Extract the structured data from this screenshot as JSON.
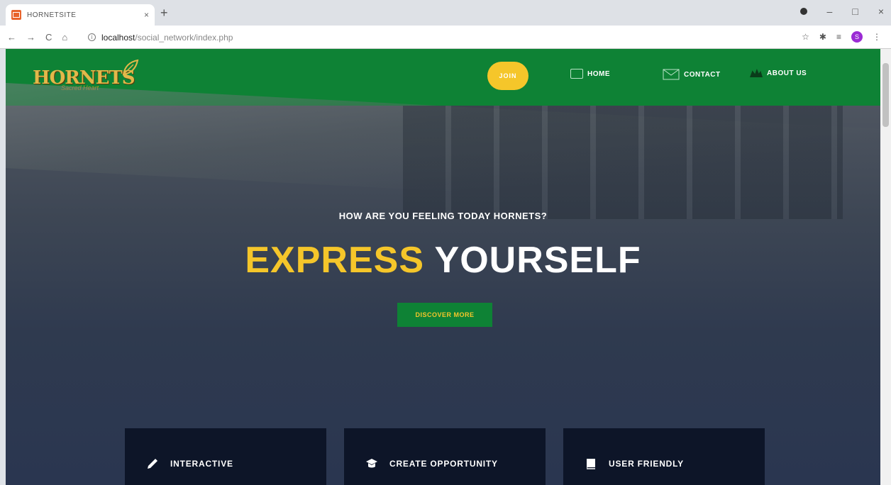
{
  "browser": {
    "tab_title": "HORNETSITE",
    "tab_close": "×",
    "new_tab": "+",
    "url_host": "localhost",
    "url_path": "/social_network/index.php",
    "nav_back": "←",
    "nav_forward": "→",
    "nav_reload": "C",
    "nav_home": "⌂",
    "win_minimize": "–",
    "win_maximize": "□",
    "win_close": "×",
    "avatar_letter": "S"
  },
  "site_nav": {
    "logo_text": "HORNETS",
    "logo_sub": "Sacred Heart",
    "join_label": "JOIN",
    "links": [
      {
        "label": "HOME",
        "icon": "home-icon"
      },
      {
        "label": "CONTACT",
        "icon": "envelope-icon"
      },
      {
        "label": "ABOUT US",
        "icon": "crown-icon"
      }
    ]
  },
  "hero": {
    "subtitle": "HOW ARE YOU FEELING TODAY HORNETS?",
    "title_highlight": "EXPRESS",
    "title_rest": "YOURSELF",
    "cta_label": "DISCOVER MORE"
  },
  "features": [
    {
      "label": "INTERACTIVE",
      "icon": "pencil-icon"
    },
    {
      "label": "CREATE OPPORTUNITY",
      "icon": "graduation-cap-icon"
    },
    {
      "label": "USER FRIENDLY",
      "icon": "book-icon"
    }
  ],
  "colors": {
    "nav_green": "#0e8235",
    "accent_yellow": "#f5c62a",
    "card_navy": "#0d1528"
  }
}
